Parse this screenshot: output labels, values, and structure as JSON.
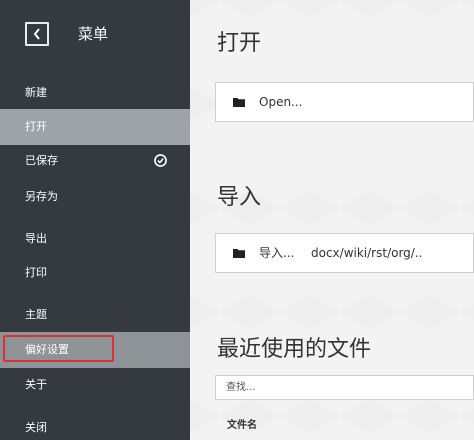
{
  "sidebar": {
    "title": "菜单",
    "back_icon": "chevron-left-icon",
    "items": [
      {
        "label": "新建"
      },
      {
        "label": "打开"
      },
      {
        "label": "已保存",
        "icon": "check-circle-icon"
      },
      {
        "label": "另存为"
      },
      {
        "label": "导出"
      },
      {
        "label": "打印"
      },
      {
        "label": "主题"
      },
      {
        "label": "偏好设置"
      },
      {
        "label": "关于"
      },
      {
        "label": "关闭"
      }
    ]
  },
  "main": {
    "open_title": "打开",
    "open_action_label": "Open...",
    "import_title": "导入",
    "import_action_label": "导入...",
    "import_formats": "docx/wiki/rst/org/..",
    "recent_title": "最近使用的文件",
    "search_placeholder": "查找...",
    "filename_header": "文件名"
  },
  "colors": {
    "sidebar_bg": "#343a40",
    "active_item_bg": "#9ea3a7",
    "highlight_border": "#e03131",
    "main_bg": "#f3f3f3"
  }
}
